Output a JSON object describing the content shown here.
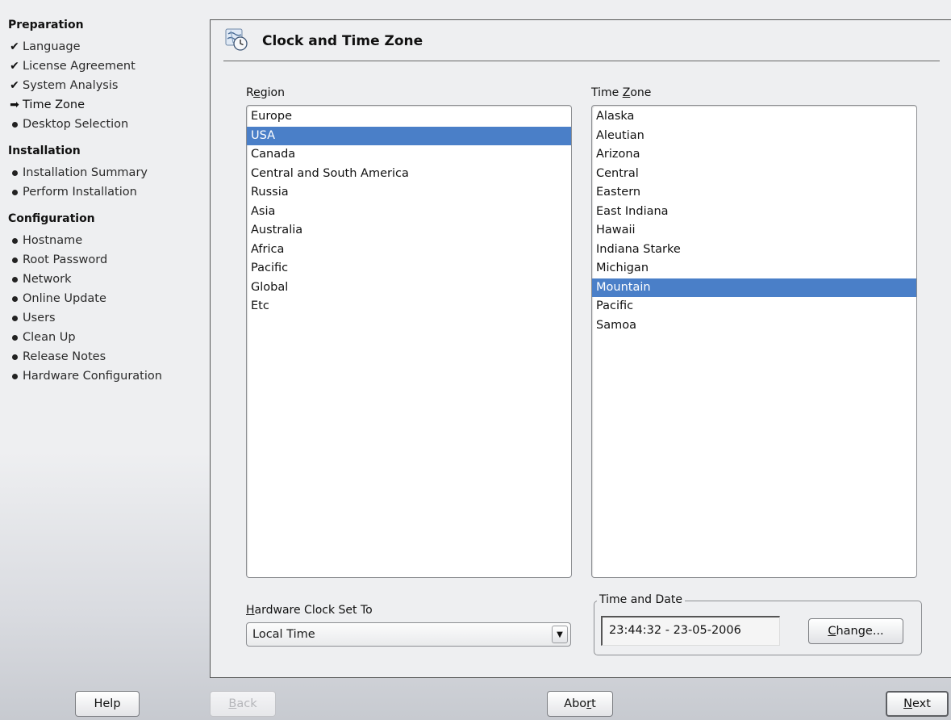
{
  "sidebar": {
    "preparation": {
      "title": "Preparation",
      "items": [
        {
          "label": "Language",
          "state": "done"
        },
        {
          "label": "License Agreement",
          "state": "done"
        },
        {
          "label": "System Analysis",
          "state": "done"
        },
        {
          "label": "Time Zone",
          "state": "current"
        },
        {
          "label": "Desktop Selection",
          "state": "pending"
        }
      ]
    },
    "installation": {
      "title": "Installation",
      "items": [
        {
          "label": "Installation Summary",
          "state": "pending"
        },
        {
          "label": "Perform Installation",
          "state": "pending"
        }
      ]
    },
    "configuration": {
      "title": "Configuration",
      "items": [
        {
          "label": "Hostname",
          "state": "pending"
        },
        {
          "label": "Root Password",
          "state": "pending"
        },
        {
          "label": "Network",
          "state": "pending"
        },
        {
          "label": "Online Update",
          "state": "pending"
        },
        {
          "label": "Users",
          "state": "pending"
        },
        {
          "label": "Clean Up",
          "state": "pending"
        },
        {
          "label": "Release Notes",
          "state": "pending"
        },
        {
          "label": "Hardware Configuration",
          "state": "pending"
        }
      ]
    }
  },
  "page": {
    "title": "Clock and Time Zone",
    "icon": "clock-globe-icon"
  },
  "region": {
    "label_pre": "R",
    "label_acc": "e",
    "label_post": "gion",
    "items": [
      "Europe",
      "USA",
      "Canada",
      "Central and South America",
      "Russia",
      "Asia",
      "Australia",
      "Africa",
      "Pacific",
      "Global",
      "Etc"
    ],
    "selected": "USA"
  },
  "timezone": {
    "label_pre": "Time ",
    "label_acc": "Z",
    "label_post": "one",
    "items": [
      "Alaska",
      "Aleutian",
      "Arizona",
      "Central",
      "Eastern",
      "East Indiana",
      "Hawaii",
      "Indiana Starke",
      "Michigan",
      "Mountain",
      "Pacific",
      "Samoa"
    ],
    "selected": "Mountain"
  },
  "hardware_clock": {
    "label_acc": "H",
    "label_post": "ardware Clock Set To",
    "value": "Local Time"
  },
  "time_date": {
    "legend": "Time and Date",
    "value": "23:44:32 - 23-05-2006",
    "change_acc": "C",
    "change_post": "hange..."
  },
  "buttons": {
    "help": "Help",
    "back_acc": "B",
    "back_post": "ack",
    "abort_pre": "Abo",
    "abort_acc": "r",
    "abort_post": "t",
    "next_acc": "N",
    "next_post": "ext"
  },
  "colors": {
    "selection": "#4a7fc8",
    "background": "#eeeff1"
  }
}
